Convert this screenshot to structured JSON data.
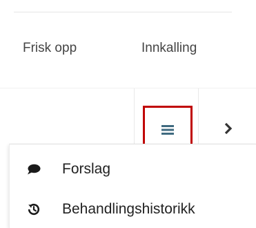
{
  "toolbar": {
    "refresh_label": "Frisk opp",
    "invite_label": "Innkalling"
  },
  "controls": {
    "menu_icon": "hamburger-icon",
    "next_icon": "chevron-right-icon",
    "highlight_color": "#c00000",
    "menu_icon_color": "#3f6a80"
  },
  "dropdown": {
    "items": [
      {
        "label": "Forslag",
        "icon": "comment-icon"
      },
      {
        "label": "Behandlingshistorikk",
        "icon": "history-icon"
      }
    ]
  }
}
